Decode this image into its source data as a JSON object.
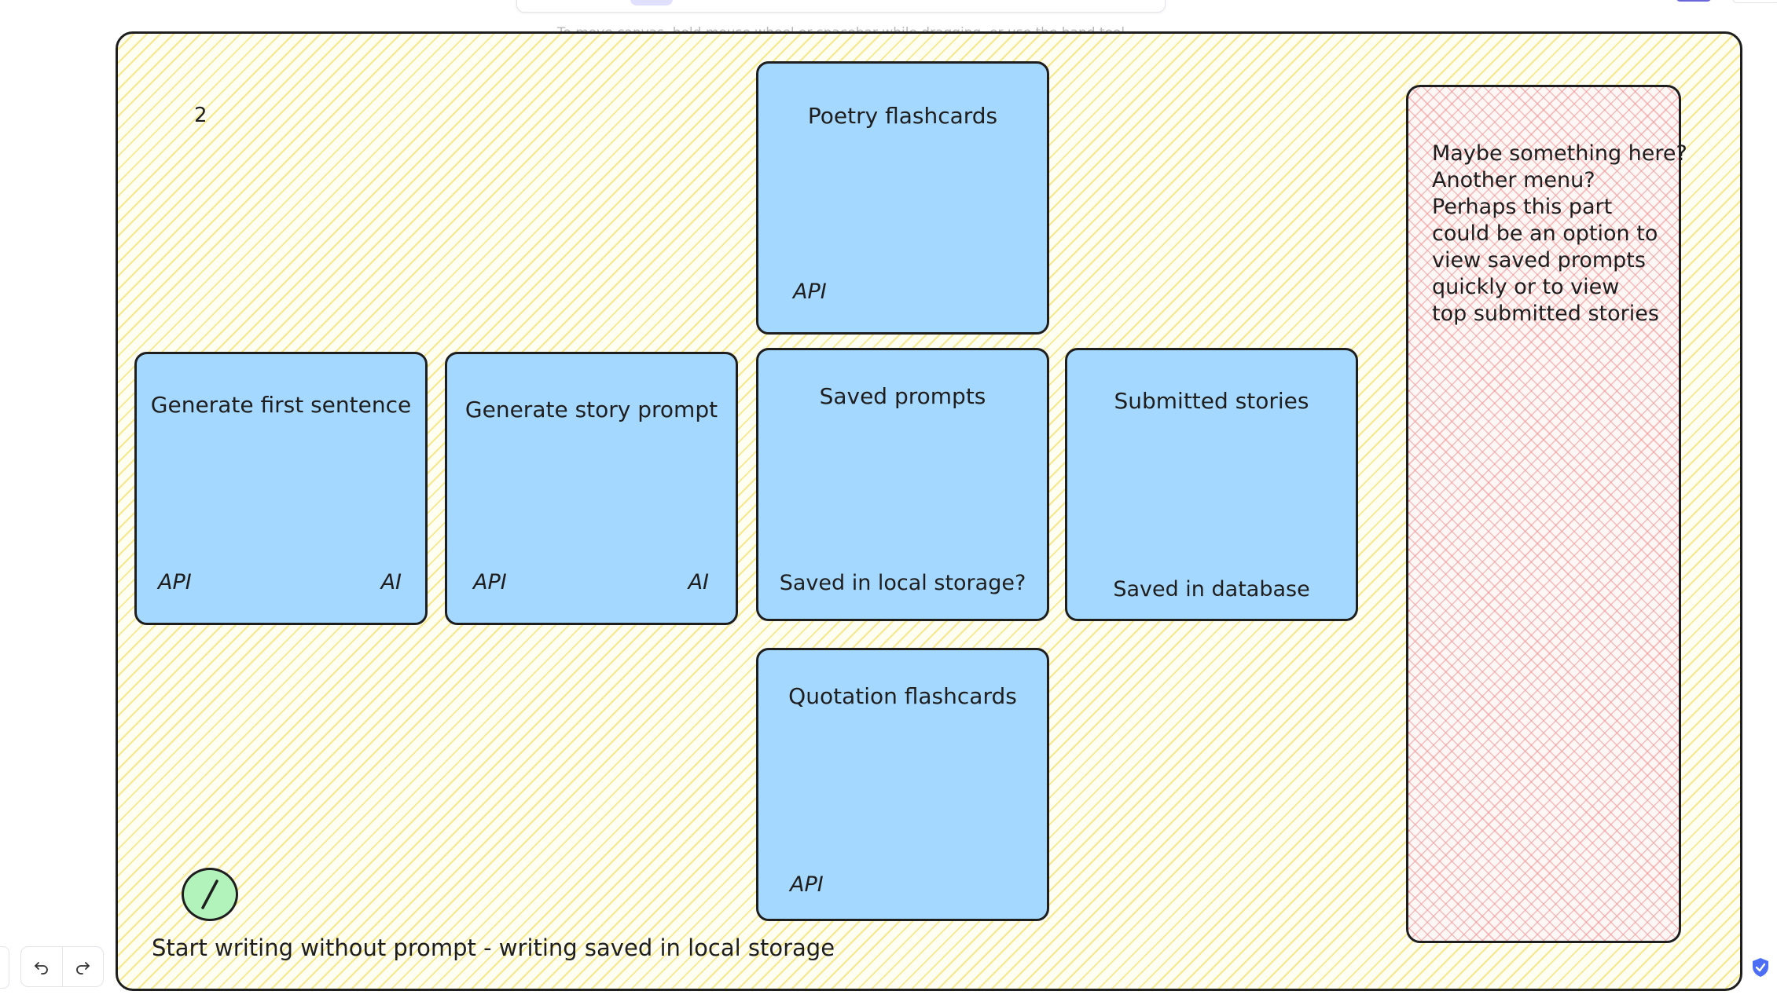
{
  "canvas_hint": "To move canvas, hold mouse wheel or spacebar while dragging, or use the hand tool",
  "frame": {
    "number_label": "2"
  },
  "cards": {
    "poetry": {
      "title": "Poetry flashcards",
      "foot_left": "API"
    },
    "first_sentence": {
      "title": "Generate first sentence",
      "foot_left": "API",
      "foot_right": "AI"
    },
    "story_prompt": {
      "title": "Generate story prompt",
      "foot_left": "API",
      "foot_right": "AI"
    },
    "saved_prompts": {
      "title": "Saved prompts",
      "foot": "Saved in local storage?"
    },
    "submitted_stories": {
      "title": "Submitted stories",
      "foot": "Saved in database"
    },
    "quotation": {
      "title": "Quotation flashcards",
      "foot_left": "API"
    }
  },
  "side_panel": {
    "lines": [
      "Maybe something here?",
      "Another menu?",
      "Perhaps this part",
      "could be an option to",
      "view saved prompts",
      "quickly or to view",
      "top submitted stories"
    ]
  },
  "bottom_caption": "Start writing without prompt - writing saved in local storage",
  "icons": {
    "undo": "undo-icon",
    "redo": "redo-icon",
    "shield": "shield-check-icon"
  },
  "colors": {
    "card_fill": "#a5d8ff",
    "frame_hatch": "#f0d73c",
    "side_hatch": "#f08c8c",
    "circle_fill": "#b2f2bb",
    "accent": "#6965db"
  }
}
